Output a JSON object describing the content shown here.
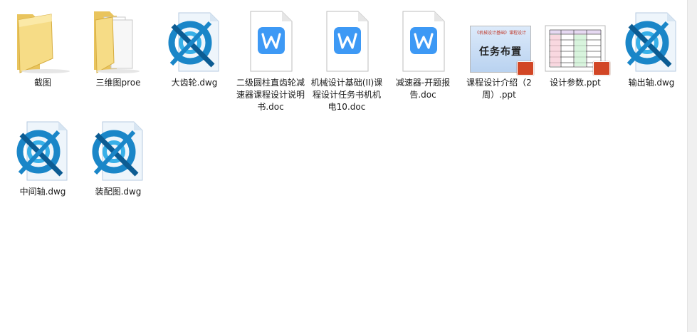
{
  "files": [
    {
      "name": "截图",
      "type": "folder",
      "icon": "folder-icon"
    },
    {
      "name": "三维图proe",
      "type": "folder",
      "icon": "folder-with-documents-icon"
    },
    {
      "name": "大齿轮.dwg",
      "type": "dwg",
      "icon": "cad-dwg-icon"
    },
    {
      "name": "二级圆柱直齿轮减速器课程设计说明书.doc",
      "type": "doc",
      "icon": "wps-writer-icon"
    },
    {
      "name": "机械设计基础(II)课程设计任务书机机电10.doc",
      "type": "doc",
      "icon": "wps-writer-icon"
    },
    {
      "name": "减速器-开题报告.doc",
      "type": "doc",
      "icon": "wps-writer-icon"
    },
    {
      "name": "课程设计介绍（2周）.ppt",
      "type": "ppt",
      "icon": "ppt-thumbnail-icon",
      "thumb_title": "《机械设计基础》课程设计",
      "thumb_heading": "任务布置"
    },
    {
      "name": "设计参数.ppt",
      "type": "ppt",
      "icon": "ppt-table-thumbnail-icon"
    },
    {
      "name": "输出轴.dwg",
      "type": "dwg",
      "icon": "cad-dwg-icon"
    },
    {
      "name": "中间轴.dwg",
      "type": "dwg",
      "icon": "cad-dwg-icon"
    },
    {
      "name": "装配图.dwg",
      "type": "dwg",
      "icon": "cad-dwg-icon"
    }
  ],
  "colors": {
    "folder": "#f3d479",
    "folder_dark": "#d9b24b",
    "wps_blue": "#3d99f5",
    "cad_blue": "#1a86c8",
    "ppt_red": "#d24625"
  }
}
